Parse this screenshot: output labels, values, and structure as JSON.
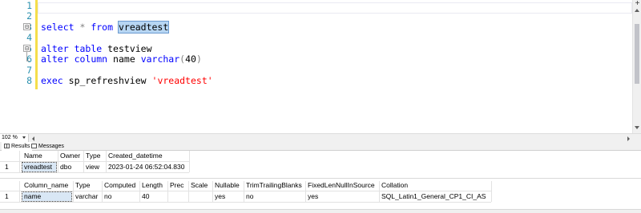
{
  "editor": {
    "line_numbers": [
      "1",
      "2",
      "3",
      "4",
      "5",
      "6",
      "7",
      "8"
    ],
    "collapse_markers": [
      "⊟",
      "⊟"
    ],
    "lines": {
      "l3": {
        "kw1": "select",
        "op": " * ",
        "kw2": "from",
        "sp": " ",
        "ident": "vreadtest"
      },
      "l5": {
        "kw1": "alter",
        "sp1": " ",
        "kw2": "table",
        "sp2": " ",
        "ident": "testview"
      },
      "l6": {
        "kw1": "alter",
        "sp1": " ",
        "kw2": "column",
        "sp2": " ",
        "ident": "name",
        "sp3": " ",
        "type": "varchar",
        "paren_open": "(",
        "num": "40",
        "paren_close": ")"
      },
      "l8": {
        "kw1": "exec",
        "sp1": " ",
        "ident": "sp_refreshview",
        "sp2": " ",
        "str": "'vreadtest'"
      }
    }
  },
  "zoom": {
    "level": "102 %"
  },
  "tabs": {
    "results": "Results",
    "messages": "Messages"
  },
  "grid1": {
    "headers": [
      "Name",
      "Owner",
      "Type",
      "Created_datetime"
    ],
    "rows": [
      {
        "num": "1",
        "cells": [
          "vreadtest",
          "dbo",
          "view",
          "2023-01-24 06:52:04.830"
        ]
      }
    ]
  },
  "grid2": {
    "headers": [
      "Column_name",
      "Type",
      "Computed",
      "Length",
      "Prec",
      "Scale",
      "Nullable",
      "TrimTrailingBlanks",
      "FixedLenNullInSource",
      "Collation"
    ],
    "rows": [
      {
        "num": "1",
        "cells": [
          "name",
          "varchar",
          "no",
          "40",
          "",
          "",
          "yes",
          "no",
          "yes",
          "SQL_Latin1_General_CP1_CI_AS"
        ]
      }
    ]
  },
  "colors": {
    "keyword": "#0000ff",
    "string": "#ff0000",
    "line_number": "#2b91af",
    "change_bar": "#f5de4b",
    "selection": "#b7d6f3"
  }
}
